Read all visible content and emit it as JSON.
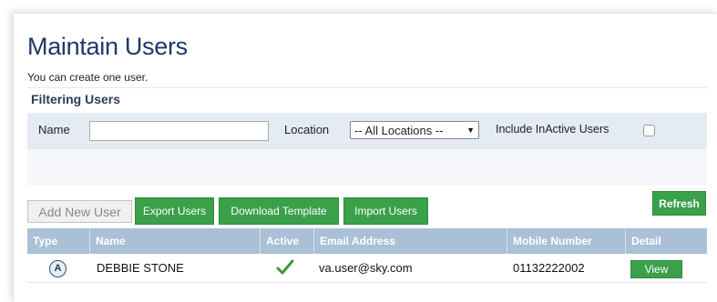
{
  "page": {
    "title": "Maintain Users",
    "subtitle": "You can create one user."
  },
  "filter": {
    "heading": "Filtering Users",
    "name_label": "Name",
    "name_value": "",
    "location_label": "Location",
    "location_selected": "-- All Locations --",
    "inactive_label": "Include InActive Users",
    "inactive_checked": false,
    "refresh_label": "Refresh"
  },
  "toolbar": {
    "add_label": "Add New User",
    "export_label": "Export Users",
    "download_label": "Download Template",
    "import_label": "Import Users"
  },
  "table": {
    "columns": [
      "Type",
      "Name",
      "Active",
      "Email Address",
      "Mobile Number",
      "Detail"
    ],
    "rows": [
      {
        "type": "A",
        "name": "DEBBIE STONE",
        "active": true,
        "email": "va.user@sky.com",
        "mobile": "01132222002",
        "detail": "View"
      }
    ]
  },
  "colors": {
    "title": "#1f3864",
    "accent_green": "#3aa04a",
    "header_bg": "#a9c0d6",
    "check_green": "#3a9a3a"
  },
  "icons": {
    "type": "admin-badge-icon",
    "active": "checkmark-icon",
    "dropdown": "dropdown-arrow-icon"
  }
}
